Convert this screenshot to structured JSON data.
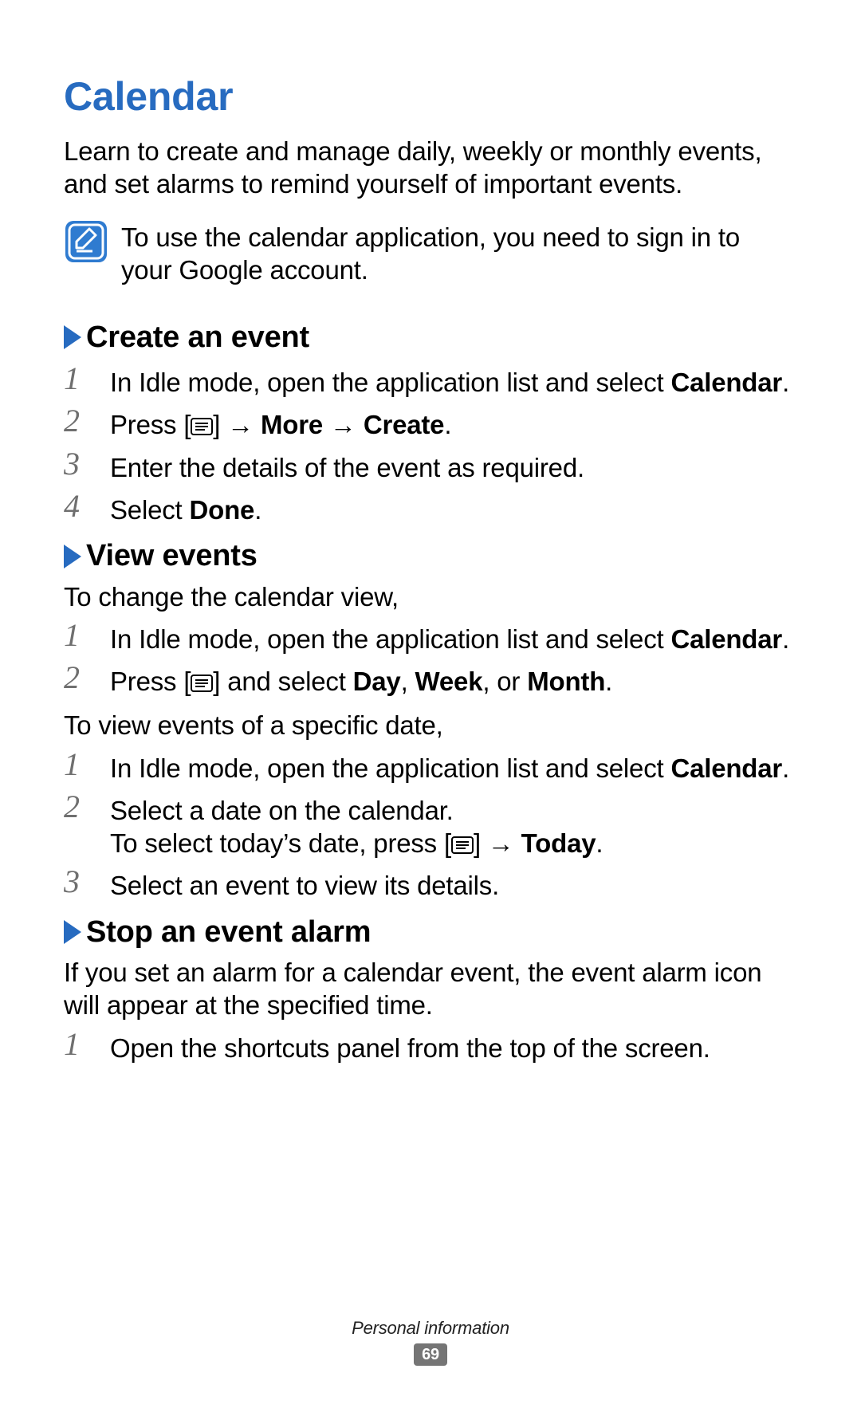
{
  "title": "Calendar",
  "intro": "Learn to create and manage daily, weekly or monthly events, and set alarms to remind yourself of important events.",
  "note": "To use the calendar application, you need to sign in to your Google account.",
  "sections": {
    "create": {
      "heading": "Create an event",
      "steps": {
        "s1a": "In Idle mode, open the application list and select ",
        "s1b": "Calendar",
        "s1c": ".",
        "s2a": "Press [",
        "s2b": "] → ",
        "s2c": "More",
        "s2d": " → ",
        "s2e": "Create",
        "s2f": ".",
        "s3": "Enter the details of the event as required.",
        "s4a": "Select ",
        "s4b": "Done",
        "s4c": "."
      }
    },
    "view": {
      "heading": "View events",
      "intro1": "To change the calendar view,",
      "stepsA": {
        "s1a": "In Idle mode, open the application list and select ",
        "s1b": "Calendar",
        "s1c": ".",
        "s2a": "Press [",
        "s2b": "] and select ",
        "s2c": "Day",
        "s2d": ", ",
        "s2e": "Week",
        "s2f": ", or ",
        "s2g": "Month",
        "s2h": "."
      },
      "intro2": "To view events of a specific date,",
      "stepsB": {
        "s1a": "In Idle mode, open the application list and select ",
        "s1b": "Calendar",
        "s1c": ".",
        "s2a": "Select a date on the calendar.",
        "s2b": "To select today’s date, press [",
        "s2c": "] → ",
        "s2d": "Today",
        "s2e": ".",
        "s3": "Select an event to view its details."
      }
    },
    "stop": {
      "heading": "Stop an event alarm",
      "intro": "If you set an alarm for a calendar event, the event alarm icon will appear at the specified time.",
      "steps": {
        "s1": "Open the shortcuts panel from the top of the screen."
      }
    }
  },
  "nums": {
    "n1": "1",
    "n2": "2",
    "n3": "3",
    "n4": "4"
  },
  "footer": {
    "section": "Personal information",
    "page": "69"
  }
}
